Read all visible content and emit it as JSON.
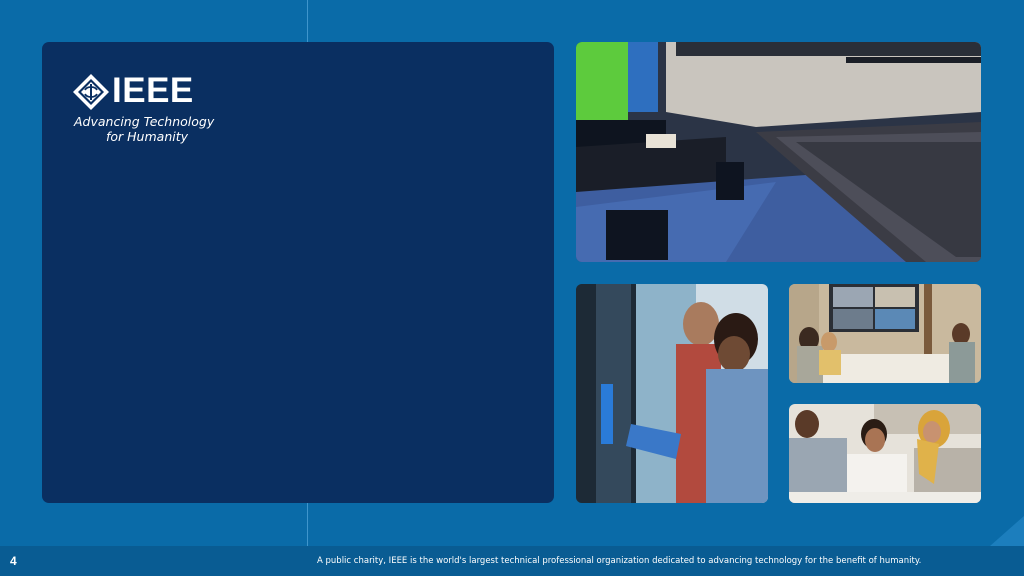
{
  "brand": {
    "wordmark": "IEEE",
    "tagline_line1": "Advancing Technology",
    "tagline_line2": "for Humanity",
    "logo_icon": "ieee-diamond-logo-icon",
    "colors": {
      "background": "#0A6BA8",
      "panel": "#0A2F61",
      "footer": "#095C93",
      "text": "#FFFFFF"
    }
  },
  "photos": [
    {
      "name": "conference-hall-photo"
    },
    {
      "name": "server-room-photo"
    },
    {
      "name": "video-meeting-photo"
    },
    {
      "name": "team-collaboration-photo"
    }
  ],
  "footer": {
    "page_number": "4",
    "text": "A public charity, IEEE is the world's largest technical professional organization dedicated to advancing technology for the benefit of humanity."
  }
}
